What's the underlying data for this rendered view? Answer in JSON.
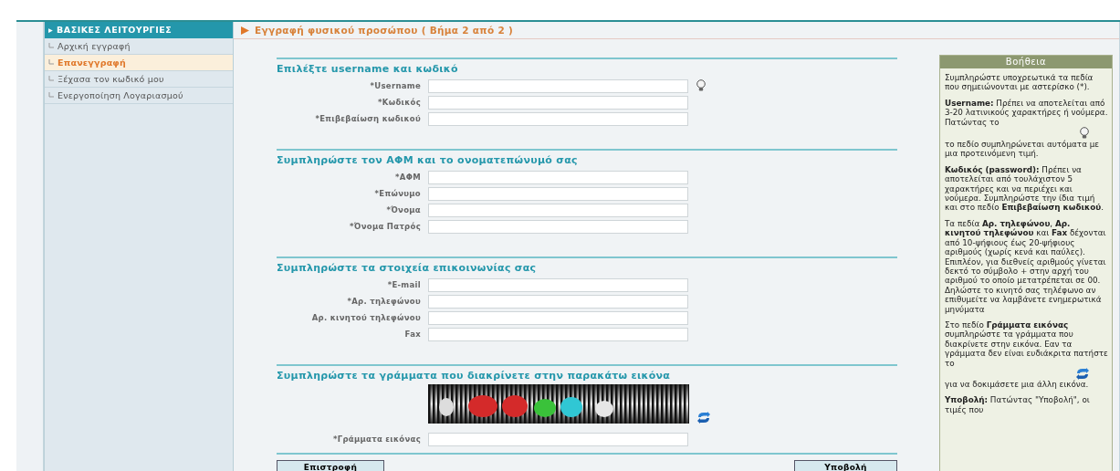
{
  "sidebar": {
    "title": "▸ ΒΑΣΙΚΕΣ ΛΕΙΤΟΥΡΓΙΕΣ",
    "items": [
      {
        "label": "Αρχική εγγραφή",
        "selected": false
      },
      {
        "label": "Επανεγγραφή",
        "selected": true
      },
      {
        "label": "Ξέχασα τον κωδικό μου",
        "selected": false
      },
      {
        "label": "Ενεργοποίηση Λογαριασμού",
        "selected": false
      }
    ]
  },
  "page_title": "Εγγραφή φυσικού προσώπου ( Βήμα 2 από 2 )",
  "sections": [
    {
      "heading": "Επιλέξτε username και κωδικό",
      "fields": [
        {
          "label": "*Username",
          "hint_icon": true
        },
        {
          "label": "*Κωδικός",
          "hint_icon": false
        },
        {
          "label": "*Επιβεβαίωση κωδικού",
          "hint_icon": false
        }
      ]
    },
    {
      "heading": "Συμπληρώστε τον ΑΦΜ και το ονοματεπώνυμό σας",
      "fields": [
        {
          "label": "*ΑΦΜ",
          "hint_icon": false
        },
        {
          "label": "*Επώνυμο",
          "hint_icon": false
        },
        {
          "label": "*Όνομα",
          "hint_icon": false
        },
        {
          "label": "*Όνομα Πατρός",
          "hint_icon": false
        }
      ]
    },
    {
      "heading": "Συμπληρώστε τα στοιχεία επικοινωνίας σας",
      "fields": [
        {
          "label": "*E-mail",
          "hint_icon": false
        },
        {
          "label": "*Αρ. τηλεφώνου",
          "hint_icon": false
        },
        {
          "label": "Αρ. κινητού τηλεφώνου",
          "hint_icon": false
        },
        {
          "label": "Fax",
          "hint_icon": false
        }
      ]
    },
    {
      "heading": "Συμπληρώστε τα γράμματα που διακρίνετε στην παρακάτω εικόνα",
      "captcha": {
        "kind": "picture"
      },
      "fields": [
        {
          "label": "*Γράμματα εικόνας",
          "hint_icon": false
        }
      ]
    }
  ],
  "buttons": [
    "Επιστροφή",
    "Υποβολή"
  ],
  "help": {
    "title": "Βοήθεια",
    "paragraphs": [
      {
        "parts": [
          {
            "kind": "text",
            "text": "Συμπληρώστε υποχρεωτικά τα πεδία που σημειώνονται με αστερίσκο (*)."
          }
        ]
      },
      {
        "parts": [
          {
            "kind": "text",
            "text": "**Username:** Πρέπει να αποτελείται από 3-20 λατινικούς χαρακτήρες ή νούμερα. Πατώντας το"
          },
          {
            "kind": "bulb"
          },
          {
            "kind": "text",
            "text": "το πεδίο συμπληρώνεται αυτόματα με μια προτεινόμενη τιμή."
          }
        ]
      },
      {
        "parts": [
          {
            "kind": "text",
            "text": "**Κωδικός (password):** Πρέπει να αποτελείται από τουλάχιστον 5 χαρακτήρες και να περιέχει και νούμερα. Συμπληρώστε την ίδια τιμή και στο πεδίο **Επιβεβαίωση κωδικού**."
          }
        ]
      },
      {
        "parts": [
          {
            "kind": "text",
            "text": "Τα πεδία **Αρ. τηλεφώνου**, **Αρ. κινητού τηλεφώνου** και **Fax** δέχονται από 10-ψήφιους έως 20-ψήφιους αριθμούς (χωρίς κενά και παύλες). Επιπλέον, για διεθνείς αριθμούς γίνεται δεκτό το σύμβολο + στην αρχή του αριθμού το οποίο μετατρέπεται σε 00. Δηλώστε το κινητό σας τηλέφωνο αν επιθυμείτε να λαμβάνετε ενημερωτικά μηνύματα"
          }
        ]
      },
      {
        "parts": [
          {
            "kind": "text",
            "text": "Στο πεδίο **Γράμματα εικόνας** συμπληρώστε τα γράμματα που διακρίνετε στην εικόνα. Εαν τα γράμματα δεν είναι ευδιάκριτα πατήστε το"
          },
          {
            "kind": "refresh"
          },
          {
            "kind": "text",
            "text": "για να δοκιμάσετε μια άλλη εικόνα."
          }
        ]
      },
      {
        "parts": [
          {
            "kind": "text",
            "text": "**Υποβολή:** Πατώντας \"Υποβολή\", οι τιμές που"
          }
        ]
      }
    ]
  }
}
